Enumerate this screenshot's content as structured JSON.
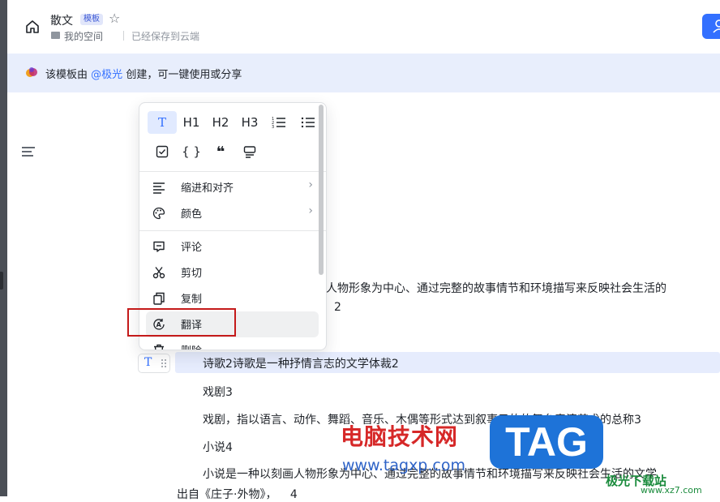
{
  "header": {
    "doc_title": "散文",
    "template_badge": "模板",
    "location": "我的空间",
    "save_status": "已经保存到云端"
  },
  "banner": {
    "prefix": "该模板由",
    "author": "@极光",
    "suffix": "创建，可一键使用或分享"
  },
  "toolbar": {
    "icons": [
      "text-icon",
      "heading1-icon",
      "heading2-icon",
      "heading3-icon",
      "ordered-list-icon",
      "bullet-list-icon",
      "todo-icon",
      "code-icon",
      "quote-icon",
      "callout-icon"
    ],
    "h1": "H1",
    "h2": "H2",
    "h3": "H3",
    "code": "{ }",
    "quote": "❝"
  },
  "menu": {
    "indent_align": "缩进和对齐",
    "color": "颜色",
    "comment": "评论",
    "cut": "剪切",
    "copy": "复制",
    "translate": "翻译",
    "delete_partial": "删除"
  },
  "document": {
    "line1": "人物形象为中心、通过完整的故事情节和环境描写来反映社会生活的",
    "line1_num": "2",
    "poem": "诗歌2诗歌是一种抒情言志的文学体裁2",
    "drama_heading": "戏剧3",
    "drama_text": "戏剧，指以语言、动作、舞蹈、音乐、木偶等形式达到叙事目的的舞台表演艺术的总称3",
    "novel_heading": "小说4",
    "novel_text": "小说是一种以刻画人物形象为中心、通过完整的故事情节和环境描写来反映社会生活的文学",
    "source": "出自《庄子·外物》，",
    "source_num": "4"
  },
  "watermark": {
    "site_cn": "电脑技术网",
    "site_url": "www.tagxp.com",
    "tag": "TAG",
    "brand": "极光下载站",
    "brand_url": "www.xz7.com"
  },
  "colors": {
    "accent": "#3370ff",
    "highlight": "#e6ecfd",
    "banner": "#e8eefc",
    "annotation": "#c41a1a"
  }
}
